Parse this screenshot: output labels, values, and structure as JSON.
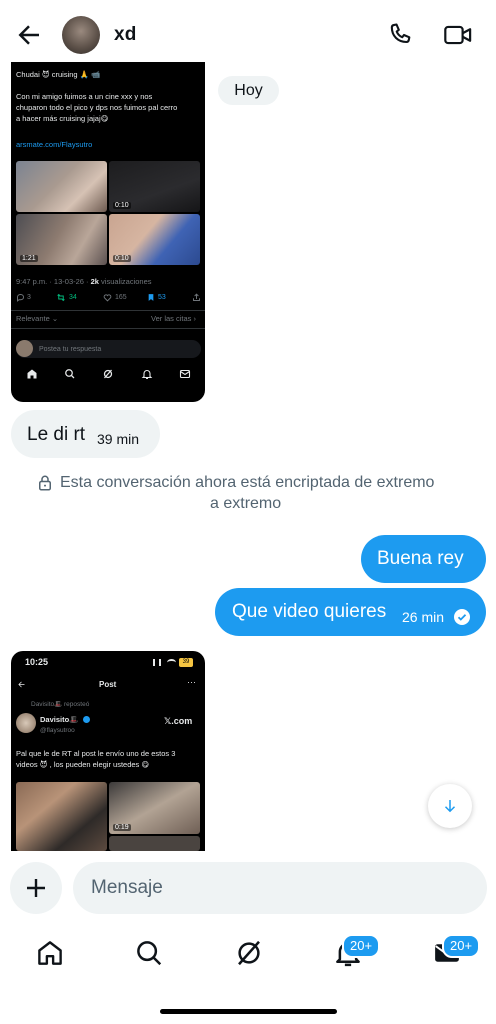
{
  "header": {
    "contact_name": "xd",
    "back_icon": "arrow-left-icon",
    "call_icon": "phone-icon",
    "video_icon": "video-camera-icon"
  },
  "date_pill": "Hoy",
  "shared_post_1": {
    "text_lines": [
      "Chudai 😈 cruising 🙏 📹",
      "Con mi amigo fuimos a un cine xxx y nos",
      "chuparon todo el pico y dps nos fuimos pal cerro",
      "a hacer más cruising jajaj😋"
    ],
    "link": "arsmate.com/Flaysutro",
    "video_durations": [
      "0:10",
      "1:21",
      "0:10"
    ],
    "meta_time": "9:47 p.m. · 13-03-26 · ",
    "meta_views": "2k",
    "meta_views_label": " visualizaciones",
    "stats": {
      "replies": "3",
      "reposts": "34",
      "likes": "165",
      "bookmarks": "53"
    },
    "relevance_label": "Relevante ⌄",
    "quotes_label": "Ver las citas ›",
    "reply_placeholder": "Postea tu respuesta"
  },
  "messages": {
    "incoming_1": {
      "text": "Le di rt",
      "time": "39 min"
    },
    "encryption_notice_line1": "Esta conversación ahora está encriptada de extremo",
    "encryption_notice_line2": "a extremo",
    "outgoing_1": {
      "text": "Buena rey"
    },
    "outgoing_2": {
      "text": "Que video quieres",
      "time": "26 min"
    }
  },
  "shared_post_2": {
    "status_time": "10:25",
    "status_battery": "39",
    "screen_title": "Post",
    "reposted_by": "Davisito🎩 reposteó",
    "author_name": "Davisito🎩",
    "author_handle": "@flaysutroo",
    "x_label": "𝕏.com",
    "text_lines": [
      "Pal que le de RT al post le envío uno de estos 3",
      "videos 😈 , los pueden elegir ustedes 😋"
    ],
    "video_duration": "0:19"
  },
  "composer": {
    "placeholder": "Mensaje"
  },
  "bottom_nav": {
    "items": [
      "home-icon",
      "search-icon",
      "grok-icon",
      "notifications-icon",
      "messages-icon"
    ],
    "notifications_badge": "20+",
    "messages_badge": "20+"
  },
  "colors": {
    "accent": "#1d9bf0",
    "bubble_in": "#eff3f4",
    "text_secondary": "#536471"
  }
}
